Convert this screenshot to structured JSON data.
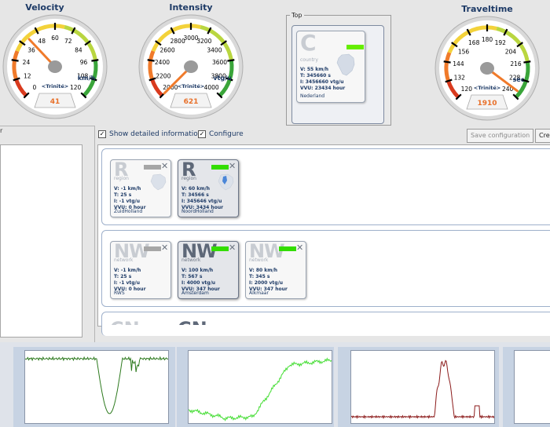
{
  "gauges": [
    {
      "id": "velocity",
      "title": "Velocity",
      "ticks": [
        "0",
        "12",
        "24",
        "36",
        "48",
        "60",
        "72",
        "84",
        "96",
        "108",
        "120"
      ],
      "unit": "km/h",
      "value": "41",
      "brand": "Trinité"
    },
    {
      "id": "intensity",
      "title": "Intensity",
      "ticks": [
        "2000",
        "2200",
        "2400",
        "2600",
        "2800",
        "3000",
        "3200",
        "3400",
        "3600",
        "3800",
        "4000"
      ],
      "unit": "vtg/u",
      "value": "621",
      "brand": "Trinité"
    },
    {
      "id": "traveltime",
      "title": "Traveltime",
      "ticks": [
        "120",
        "132",
        "144",
        "156",
        "168",
        "180",
        "192",
        "204",
        "216",
        "228",
        "240"
      ],
      "unit": "sec",
      "value": "1910",
      "brand": "Trinité"
    }
  ],
  "top": {
    "label": "Top",
    "tile": {
      "letter": "C",
      "type": "country",
      "v": "V: 55 km/h",
      "t": "T: 345660 s",
      "i": "I: 3456660 vtg/u",
      "vvu": "VVU: 23434 hour",
      "name": "Nederland",
      "bar_color": "#66ee00"
    }
  },
  "left_panel": {
    "label": "r"
  },
  "options": {
    "show_detailed": "Show detailed information",
    "configure": "Configure",
    "save_button": "Save configuration",
    "create_button": "Cre"
  },
  "region_tiles": [
    {
      "letter": "R",
      "type": "region",
      "v": "V: -1 km/h",
      "t": "T: 25 s",
      "i": "I: -1 vtg/u",
      "vvu": "VVU: 0 hour",
      "name": "ZuidHolland",
      "bar_color": "#a6a6a6",
      "selected": false
    },
    {
      "letter": "R",
      "type": "region",
      "v": "V: 60 km/h",
      "t": "T: 34566 s",
      "i": "I: 345646 vtg/u",
      "vvu": "VVU: 3434 hour",
      "name": "NoordHolland",
      "bar_color": "#33dd00",
      "selected": true
    }
  ],
  "network_tiles": [
    {
      "letter": "NW",
      "type": "network",
      "v": "V: -1 km/h",
      "t": "T: 25 s",
      "i": "I: -1 vtg/u",
      "vvu": "VVU: 0 hour",
      "name": "RWS",
      "bar_color": "#a6a6a6",
      "selected": false
    },
    {
      "letter": "NW",
      "type": "network",
      "v": "V: 100 km/h",
      "t": "T: 567 s",
      "i": "I: 4000 vtg/u",
      "vvu": "VVU: 347 hour",
      "name": "Amsterdam",
      "bar_color": "#33dd00",
      "selected": true
    },
    {
      "letter": "NW",
      "type": "network",
      "v": "V: 80 km/h",
      "t": "T: 345 s",
      "i": "I: 2000 vtg/u",
      "vvu": "VVU: 347 hour",
      "name": "Alkmaar",
      "bar_color": "#33dd00",
      "selected": false
    }
  ],
  "partial_tiles": [
    "CN",
    "CN"
  ],
  "colors": {
    "accent": "#1d3a66",
    "needle": "#f07a2a",
    "value": "#e8702a",
    "line1": "#2d7a1e",
    "line2": "#44dd33",
    "line3": "#8b1a1a"
  }
}
